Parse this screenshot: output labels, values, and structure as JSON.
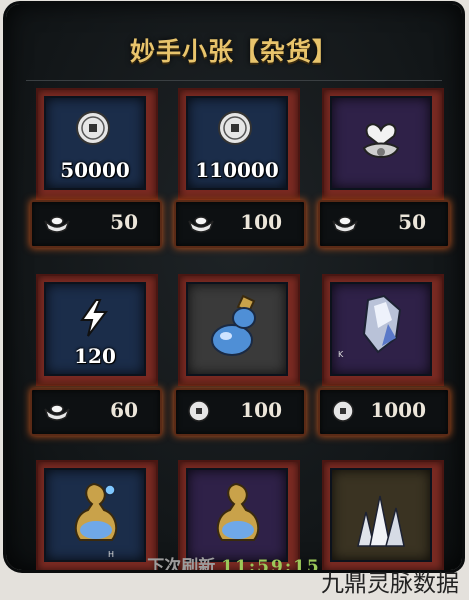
{
  "shop": {
    "title": "妙手小张【杂货】",
    "items": [
      {
        "amount": "50000",
        "price": "50",
        "currency": "silver-ingot-icon",
        "item": "copper-coin-icon"
      },
      {
        "amount": "110000",
        "price": "100",
        "currency": "silver-ingot-icon",
        "item": "copper-coin-icon"
      },
      {
        "amount": "",
        "price": "50",
        "currency": "silver-ingot-icon",
        "item": "heart-crest-icon"
      },
      {
        "amount": "120",
        "price": "60",
        "currency": "silver-ingot-icon",
        "item": "lightning-energy-icon"
      },
      {
        "amount": "",
        "price": "100",
        "currency": "copper-coin-icon",
        "item": "blue-gourd-icon"
      },
      {
        "amount": "",
        "price": "1000",
        "currency": "copper-coin-icon",
        "item": "crystal-shard-icon"
      },
      {
        "amount": "",
        "price": "",
        "currency": "",
        "item": "golden-flask-icon"
      },
      {
        "amount": "",
        "price": "",
        "currency": "",
        "item": "golden-flask-icon"
      },
      {
        "amount": "",
        "price": "",
        "currency": "",
        "item": "crystal-cluster-icon"
      }
    ],
    "item_tags": {
      "k": "K",
      "h": "H"
    },
    "refresh_label": "下次刷新",
    "refresh_time": "11:59:15"
  },
  "watermark": "九鼎灵脉数据",
  "colors": {
    "accent": "#e8c46c",
    "frame": "#7a2a22",
    "glow": "#c2541b",
    "timer": "#9cc95a"
  }
}
